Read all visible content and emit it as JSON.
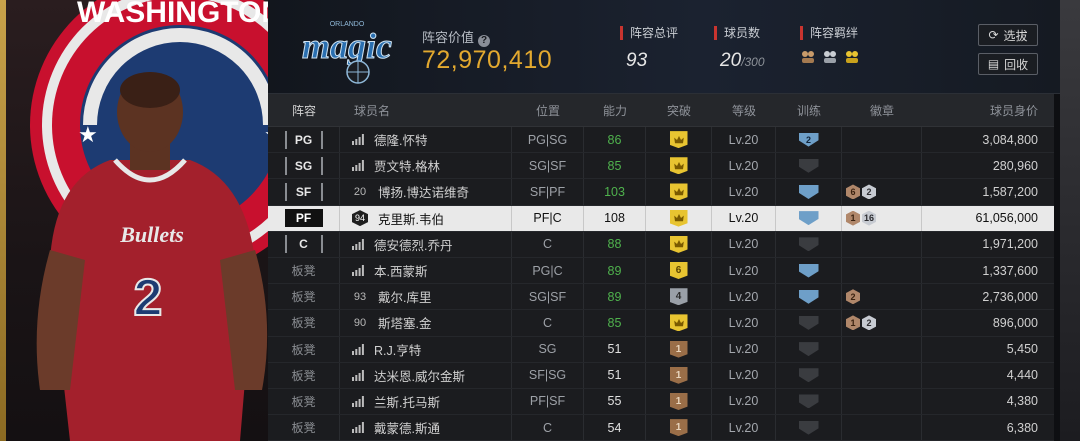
{
  "header": {
    "team_value_label": "阵容价值",
    "team_value": "72,970,410",
    "rating_label": "阵容总评",
    "rating_value": "93",
    "players_label": "球员数",
    "players_count": "20",
    "players_max": "/300",
    "chemistry_label": "阵容羁绊",
    "select_button": "选拔",
    "recycle_button": "回收"
  },
  "columns": {
    "lineup": "阵容",
    "name": "球员名",
    "position": "位置",
    "ability": "能力",
    "breakthrough": "突破",
    "level": "等级",
    "training": "训练",
    "badges": "徽章",
    "value": "球员身价"
  },
  "rows": [
    {
      "slot": "PG",
      "ovr": "",
      "name": "德隆.怀特",
      "pos": "PG|SG",
      "ability": "86",
      "abilityColor": "green",
      "brk": "",
      "brkType": "gold",
      "level": "Lv.20",
      "train": "2",
      "trainType": "blue",
      "badges": [],
      "value": "3,084,800"
    },
    {
      "slot": "SG",
      "ovr": "",
      "name": "贾文特.格林",
      "pos": "SG|SF",
      "ability": "85",
      "abilityColor": "green",
      "brk": "",
      "brkType": "gold",
      "level": "Lv.20",
      "train": "",
      "trainType": "dark",
      "badges": [],
      "value": "280,960"
    },
    {
      "slot": "SF",
      "ovr": "20",
      "name": "博扬.博达诺维奇",
      "pos": "SF|PF",
      "ability": "103",
      "abilityColor": "green",
      "brk": "",
      "brkType": "gold",
      "level": "Lv.20",
      "train": "",
      "trainType": "blue",
      "badges": [
        {
          "t": "bronze",
          "n": "6"
        },
        {
          "t": "silver",
          "n": "2"
        }
      ],
      "value": "1,587,200"
    },
    {
      "slot": "PF",
      "ovr": "94",
      "name": "克里斯.韦伯",
      "pos": "PF|C",
      "ability": "108",
      "abilityColor": "white",
      "brk": "",
      "brkType": "gold",
      "level": "Lv.20",
      "train": "",
      "trainType": "blue",
      "badges": [
        {
          "t": "bronze",
          "n": "1"
        },
        {
          "t": "silver",
          "n": "16"
        }
      ],
      "value": "61,056,000",
      "selected": true
    },
    {
      "slot": "C",
      "ovr": "",
      "name": "德安德烈.乔丹",
      "pos": "C",
      "ability": "88",
      "abilityColor": "green",
      "brk": "",
      "brkType": "gold",
      "level": "Lv.20",
      "train": "",
      "trainType": "dark",
      "badges": [],
      "value": "1,971,200"
    },
    {
      "slot": "板凳",
      "ovr": "",
      "name": "本.西蒙斯",
      "pos": "PG|C",
      "ability": "89",
      "abilityColor": "green",
      "brk": "6",
      "brkType": "gold",
      "level": "Lv.20",
      "train": "",
      "trainType": "blue",
      "badges": [],
      "value": "1,337,600"
    },
    {
      "slot": "板凳",
      "ovr": "93",
      "name": "戴尔.库里",
      "pos": "SG|SF",
      "ability": "89",
      "abilityColor": "green",
      "brk": "4",
      "brkType": "silver",
      "level": "Lv.20",
      "train": "",
      "trainType": "blue",
      "badges": [
        {
          "t": "bronze",
          "n": "2"
        }
      ],
      "value": "2,736,000"
    },
    {
      "slot": "板凳",
      "ovr": "90",
      "name": "斯塔塞.金",
      "pos": "C",
      "ability": "85",
      "abilityColor": "green",
      "brk": "",
      "brkType": "gold",
      "level": "Lv.20",
      "train": "",
      "trainType": "dark",
      "badges": [
        {
          "t": "bronze",
          "n": "1"
        },
        {
          "t": "silver",
          "n": "2"
        }
      ],
      "value": "896,000"
    },
    {
      "slot": "板凳",
      "ovr": "",
      "name": "R.J.亨特",
      "pos": "SG",
      "ability": "51",
      "abilityColor": "white",
      "brk": "1",
      "brkType": "bronze",
      "level": "Lv.20",
      "train": "",
      "trainType": "dark",
      "badges": [],
      "value": "5,450"
    },
    {
      "slot": "板凳",
      "ovr": "",
      "name": "达米恩.威尔金斯",
      "pos": "SF|SG",
      "ability": "51",
      "abilityColor": "white",
      "brk": "1",
      "brkType": "bronze",
      "level": "Lv.20",
      "train": "",
      "trainType": "dark",
      "badges": [],
      "value": "4,440"
    },
    {
      "slot": "板凳",
      "ovr": "",
      "name": "兰斯.托马斯",
      "pos": "PF|SF",
      "ability": "55",
      "abilityColor": "white",
      "brk": "1",
      "brkType": "bronze",
      "level": "Lv.20",
      "train": "",
      "trainType": "dark",
      "badges": [],
      "value": "4,380"
    },
    {
      "slot": "板凳",
      "ovr": "",
      "name": "戴蒙德.斯通",
      "pos": "C",
      "ability": "54",
      "abilityColor": "white",
      "brk": "1",
      "brkType": "bronze",
      "level": "Lv.20",
      "train": "",
      "trainType": "dark",
      "badges": [],
      "value": "6,380"
    }
  ],
  "colors": {
    "accent_gold": "#e3a92f",
    "label_red": "#c9342f",
    "ability_green": "#4fb24d"
  },
  "icons": [
    "help-icon",
    "signal-icon",
    "crown-icon",
    "refresh-icon",
    "recycle-icon",
    "chemistry-icon"
  ],
  "logo_text": {
    "team_logo": "WASHINGTON",
    "jersey_name": "Bullets",
    "jersey_number": "2",
    "header_logo": "magic",
    "header_logo_city": "ORLANDO"
  }
}
